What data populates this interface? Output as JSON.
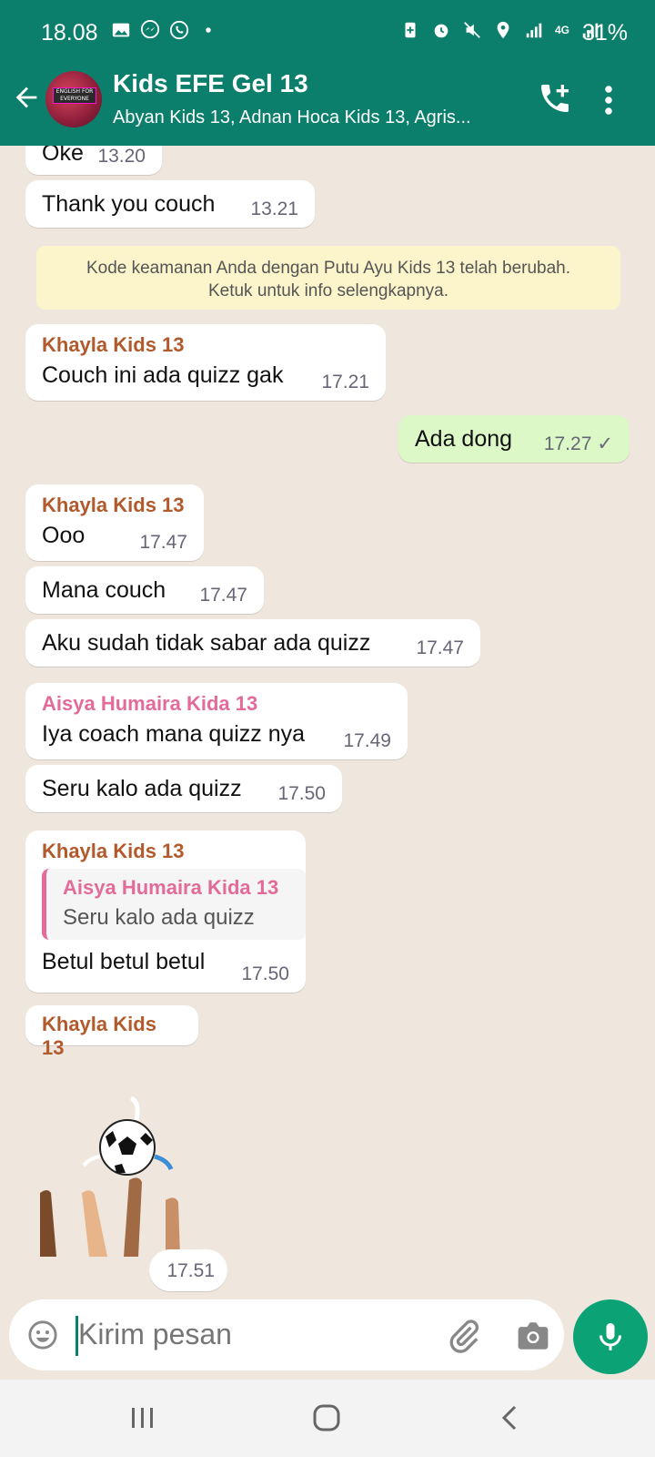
{
  "status_bar": {
    "time": "18.08",
    "battery": "31%",
    "network": "4G",
    "icons_left": [
      "gallery-icon",
      "messenger-icon",
      "whatsapp-icon",
      "dot-icon"
    ],
    "icons_right": [
      "battery-saver-icon",
      "alarm-icon",
      "mute-icon",
      "location-icon",
      "signal-icon",
      "signal-icon"
    ]
  },
  "header": {
    "title": "Kids EFE Gel 13",
    "subtitle": "Abyan Kids 13, Adnan Hoca Kids 13, Agris...",
    "avatar_text": "ENGLISH FOR EVERYONE",
    "icons": [
      "back-arrow-icon",
      "add-call-icon",
      "more-vert-icon"
    ]
  },
  "messages": [
    {
      "text": "Oke",
      "time": "13.20"
    },
    {
      "text": "Thank you couch",
      "time": "13.21"
    },
    {
      "system": "Kode keamanan Anda dengan Putu Ayu Kids 13 telah berubah.",
      "system2": "Ketuk untuk info selengkapnya."
    },
    {
      "sender": "Khayla Kids 13",
      "text": "Couch ini ada quizz gak",
      "time": "17.21"
    },
    {
      "text": "Ada dong",
      "time": "17.27",
      "outgoing": true,
      "status": "✓"
    },
    {
      "sender": "Khayla Kids 13",
      "text": "Ooo",
      "time": "17.47"
    },
    {
      "text": "Mana couch",
      "time": "17.47"
    },
    {
      "text": "Aku sudah tidak sabar ada quizz",
      "time": "17.47"
    },
    {
      "sender": "Aisya Humaira Kida 13",
      "text": "Iya coach mana quizz nya",
      "time": "17.49"
    },
    {
      "text": "Seru kalo ada quizz",
      "time": "17.50"
    },
    {
      "sender": "Khayla Kids 13",
      "quote_sender": "Aisya Humaira Kida 13",
      "quote_text": "Seru kalo ada quizz",
      "text": "Betul betul betul",
      "time": "17.50"
    },
    {
      "sender": "Khayla Kids 13",
      "sticker": "soccer-ball-sticker",
      "time": "17.51"
    }
  ],
  "input": {
    "placeholder": "Kirim pesan",
    "icons": [
      "emoji-icon",
      "attach-icon",
      "camera-icon",
      "mic-icon"
    ]
  },
  "nav": {
    "icons": [
      "recents-icon",
      "home-icon",
      "back-icon"
    ]
  },
  "colors": {
    "header": "#0b7f6b",
    "outgoing_bubble": "#dcf8c6",
    "sender_brown": "#b25a2b",
    "sender_pink": "#e36b9a",
    "mic_button": "#0ba276"
  }
}
